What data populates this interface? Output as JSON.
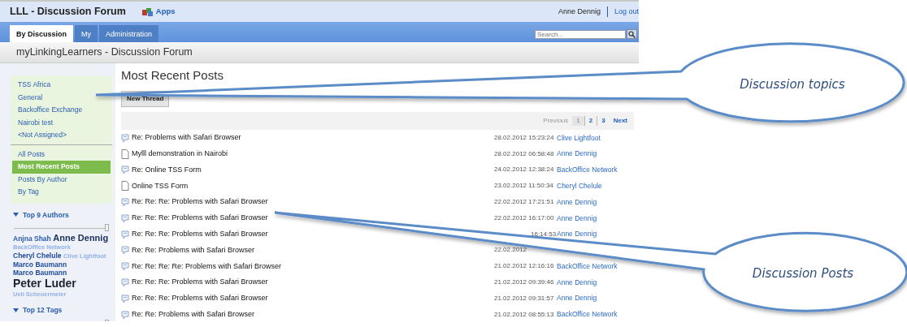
{
  "header": {
    "app_title": "LLL - Discussion Forum",
    "apps_link": "Apps",
    "user": "Anne Dennig",
    "logout": "Log out"
  },
  "tabs": [
    {
      "label": "By Discussion",
      "selected": true
    },
    {
      "label": "My",
      "selected": false
    },
    {
      "label": "Administration",
      "selected": false
    }
  ],
  "search": {
    "placeholder": "Search..."
  },
  "page_title": "myLinkingLearners - Discussion Forum",
  "sidebar": {
    "topics": [
      "TSS Africa",
      "General",
      "Backoffice Exchange",
      "Nairobi test",
      "<Not Assigned>"
    ],
    "views": [
      {
        "label": "All Posts",
        "selected": false
      },
      {
        "label": "Most Recent Posts",
        "selected": true
      },
      {
        "label": "Posts By Author",
        "selected": false
      },
      {
        "label": "By Tag",
        "selected": false
      }
    ],
    "authors_section": {
      "title": "Top 9 Authors",
      "tags": [
        {
          "name": "Anjna Shah",
          "kind": "small"
        },
        {
          "name": "Anne Dennig",
          "kind": "large"
        },
        {
          "name": "BackOffice Network",
          "kind": "faint"
        },
        {
          "name": "Cheryl Chelule",
          "kind": "medium"
        },
        {
          "name": "Clive Lightfoot",
          "kind": "faint"
        },
        {
          "name": "Marco Baumann",
          "kind": "medium"
        },
        {
          "name": "Marco Baumann",
          "kind": "medium"
        },
        {
          "name": "Peter Luder",
          "kind": "huge"
        },
        {
          "name": "Ueli Scheuermeier",
          "kind": "faint"
        }
      ]
    },
    "tags_section": {
      "title": "Top 12 Tags"
    }
  },
  "main": {
    "title": "Most Recent Posts",
    "new_thread": "New Thread",
    "pagination": [
      {
        "label": "Previous",
        "kind": "disabled"
      },
      {
        "label": "1",
        "kind": "page",
        "selected": true
      },
      {
        "label": "2",
        "kind": "page",
        "selected": false
      },
      {
        "label": "3",
        "kind": "page",
        "selected": false
      },
      {
        "label": "Next",
        "kind": "link"
      }
    ],
    "posts": [
      {
        "kind": "reply",
        "title": "Re: Problems with Safari Browser",
        "date": "28.02.2012 15:23:24",
        "author": "Clive Lightfoot"
      },
      {
        "kind": "thread",
        "title": "Mylll demonstration in Nairobi",
        "date": "28.02.2012 06:58:48",
        "author": "Anne Dennig"
      },
      {
        "kind": "reply",
        "title": "Re: Online TSS Form",
        "date": "24.02.2012 12:38:24",
        "author": "BackOffice Network"
      },
      {
        "kind": "thread",
        "title": "Online TSS Form",
        "date": "23.02.2012 11:50:34",
        "author": "Cheryl Chelule"
      },
      {
        "kind": "reply",
        "title": "Re: Re: Re: Problems with Safari Browser",
        "date": "22.02.2012 17:21:51",
        "author": "Anne Dennig"
      },
      {
        "kind": "reply",
        "title": "Re: Re: Re: Problems with Safari Browser",
        "date": "22.02.2012 16:17:00",
        "author": "Anne Dennig"
      },
      {
        "kind": "reply",
        "title": "Re: Re: Re: Problems with Safari Browser",
        "time": "16:14:53",
        "author": "Anne Dennig"
      },
      {
        "kind": "reply",
        "title": "Re: Re: Problems with Safari Browser",
        "day": "22.02.2012"
      },
      {
        "kind": "reply",
        "title": "Re: Re: Re: Re: Problems with Safari Browser",
        "date": "21.02.2012 12:16:16",
        "author": "BackOffice Network"
      },
      {
        "kind": "reply",
        "title": "Re: Re: Re: Problems with Safari Browser",
        "date": "21.02.2012 09:39:46",
        "author": "Anne Dennig"
      },
      {
        "kind": "reply",
        "title": "Re: Re: Re: Problems with Safari Browser",
        "date": "21.02.2012 09:31:57",
        "author": "Anne Dennig"
      },
      {
        "kind": "reply",
        "title": "Re: Re: Problems with Safari Browser",
        "date": "21.02.2012 08:55:13",
        "author": "BackOffice Network"
      }
    ]
  },
  "annotations": [
    {
      "text": "Discussion topics"
    },
    {
      "text": "Discussion Posts"
    }
  ]
}
